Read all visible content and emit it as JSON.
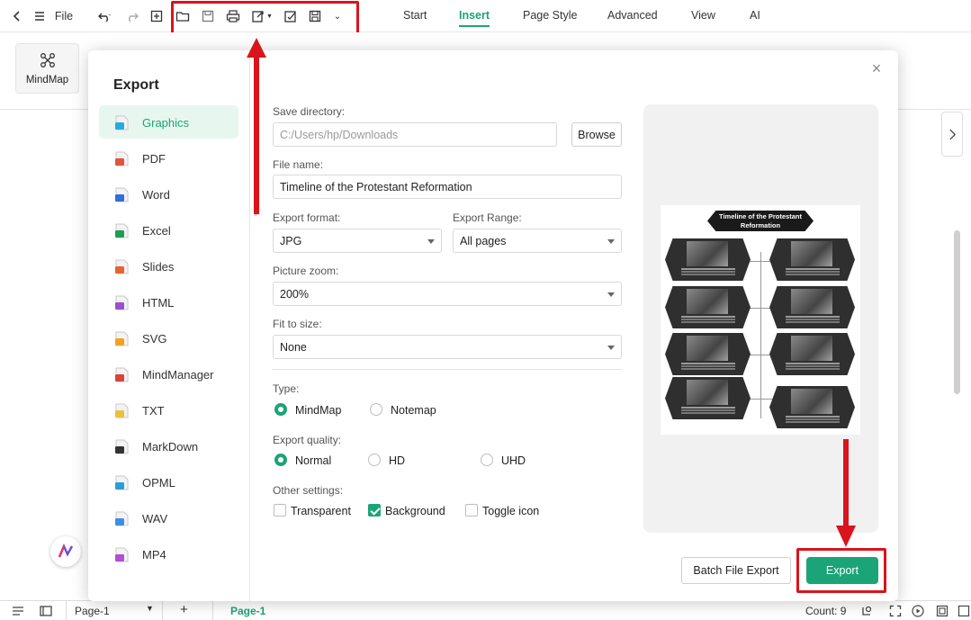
{
  "topbar": {
    "file_label": "File",
    "tabs": [
      "Start",
      "Insert",
      "Page Style",
      "Advanced",
      "View",
      "AI"
    ],
    "active_tab": "Insert"
  },
  "ribbon": {
    "mindmap_label": "MindMap"
  },
  "export_dialog": {
    "title": "Export",
    "formats": [
      "Graphics",
      "PDF",
      "Word",
      "Excel",
      "Slides",
      "HTML",
      "SVG",
      "MindManager",
      "TXT",
      "MarkDown",
      "OPML",
      "WAV",
      "MP4"
    ],
    "active_format": "Graphics",
    "format_colors": {
      "Graphics": "#27a9e1",
      "PDF": "#e0533e",
      "Word": "#2f6fd6",
      "Excel": "#1f9d55",
      "Slides": "#e6642e",
      "HTML": "#9b4fd1",
      "SVG": "#f0a321",
      "MindManager": "#d9433a",
      "TXT": "#e8c23a",
      "MarkDown": "#333333",
      "OPML": "#2a9fd6",
      "WAV": "#3b8ee8",
      "MP4": "#b04fd1"
    },
    "save_directory": {
      "label": "Save directory:",
      "value": "C:/Users/hp/Downloads",
      "browse_label": "Browse"
    },
    "file_name": {
      "label": "File name:",
      "value": "Timeline of the Protestant Reformation"
    },
    "export_format": {
      "label": "Export format:",
      "value": "JPG"
    },
    "export_range": {
      "label": "Export Range:",
      "value": "All pages"
    },
    "picture_zoom": {
      "label": "Picture zoom:",
      "value": "200%"
    },
    "fit_to_size": {
      "label": "Fit to size:",
      "value": "None"
    },
    "type": {
      "label": "Type:",
      "options": [
        "MindMap",
        "Notemap"
      ],
      "selected": "MindMap"
    },
    "export_quality": {
      "label": "Export quality:",
      "options": [
        "Normal",
        "HD",
        "UHD"
      ],
      "selected": "Normal"
    },
    "other_settings": {
      "label": "Other settings:",
      "options": [
        {
          "label": "Transparent",
          "checked": false
        },
        {
          "label": "Background",
          "checked": true
        },
        {
          "label": "Toggle icon",
          "checked": false
        }
      ]
    },
    "preview": {
      "title": "Timeline of the Protestant Reformation"
    },
    "batch_label": "Batch File Export",
    "export_label": "Export"
  },
  "status": {
    "page_select": "Page-1",
    "page_tab": "Page-1",
    "count": "Count: 9"
  },
  "colors": {
    "accent": "#1aa477",
    "highlight": "#d9141d"
  }
}
